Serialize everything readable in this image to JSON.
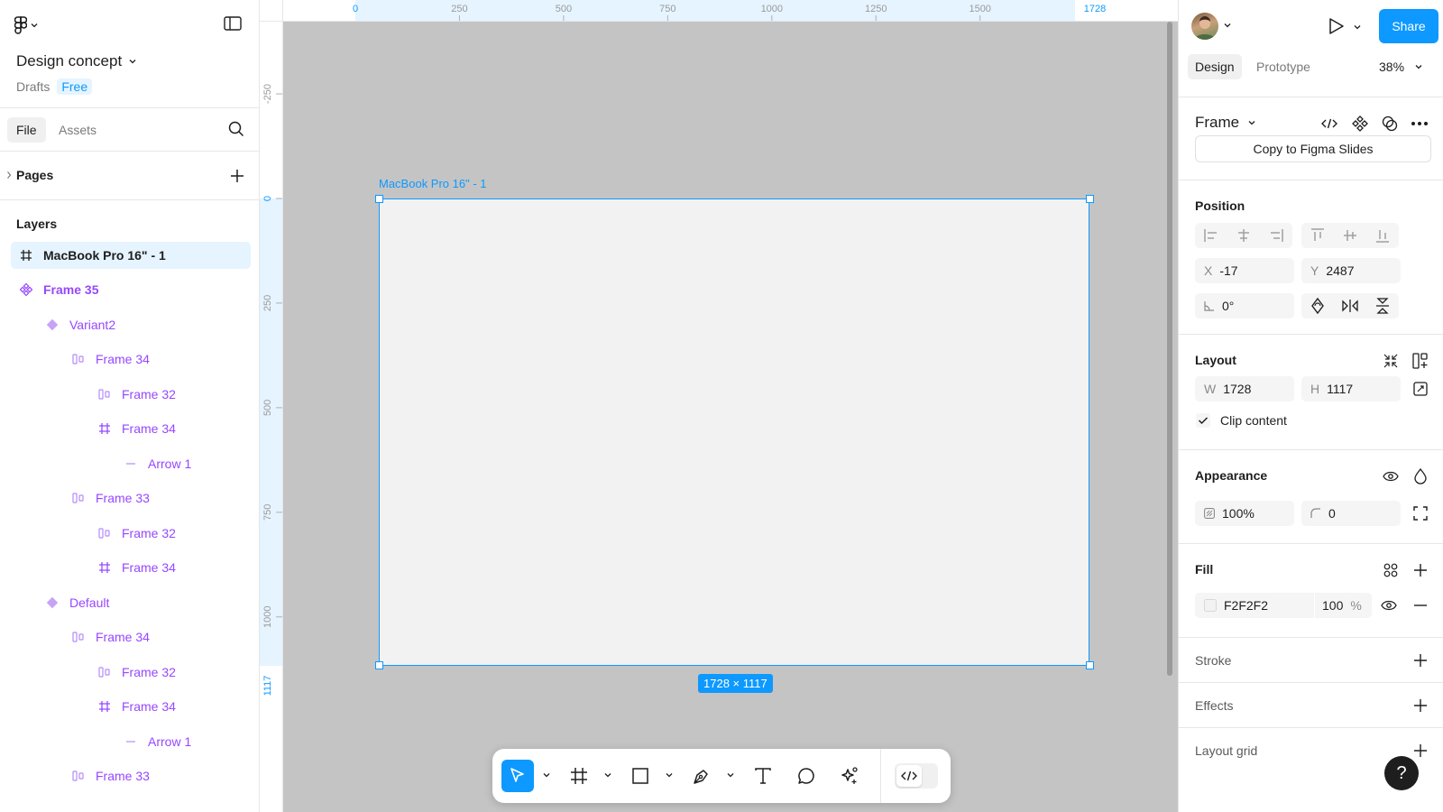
{
  "file": {
    "title": "Design concept",
    "location": "Drafts",
    "plan": "Free"
  },
  "left_tabs": {
    "file": "File",
    "assets": "Assets"
  },
  "pages": {
    "label": "Pages"
  },
  "layers": {
    "label": "Layers",
    "items": [
      {
        "name": "MacBook Pro 16\" - 1",
        "icon": "frame-icon",
        "depth": 0,
        "selected": true
      },
      {
        "name": "Frame 35",
        "icon": "component-set-icon",
        "depth": 0
      },
      {
        "name": "Variant2",
        "icon": "variant-icon",
        "depth": 1
      },
      {
        "name": "Frame 34",
        "icon": "auto-layout-icon",
        "depth": 2
      },
      {
        "name": "Frame 32",
        "icon": "auto-layout-icon",
        "depth": 3
      },
      {
        "name": "Frame 34",
        "icon": "frame-icon",
        "depth": 3
      },
      {
        "name": "Arrow 1",
        "icon": "line-icon",
        "depth": 4
      },
      {
        "name": "Frame 33",
        "icon": "auto-layout-icon",
        "depth": 2
      },
      {
        "name": "Frame 32",
        "icon": "auto-layout-icon",
        "depth": 3
      },
      {
        "name": "Frame 34",
        "icon": "frame-icon",
        "depth": 3
      },
      {
        "name": "Default",
        "icon": "variant-icon",
        "depth": 1
      },
      {
        "name": "Frame 34",
        "icon": "auto-layout-icon",
        "depth": 2
      },
      {
        "name": "Frame 32",
        "icon": "auto-layout-icon",
        "depth": 3
      },
      {
        "name": "Frame 34",
        "icon": "frame-icon",
        "depth": 3
      },
      {
        "name": "Arrow 1",
        "icon": "line-icon",
        "depth": 4
      },
      {
        "name": "Frame 33",
        "icon": "auto-layout-icon",
        "depth": 2
      }
    ]
  },
  "ruler_top": {
    "start": "0",
    "ticks": [
      "250",
      "500",
      "750",
      "1000",
      "1250",
      "1500"
    ],
    "end": "1728"
  },
  "ruler_left": {
    "ticks": [
      "-250",
      "0",
      "250",
      "500",
      "750",
      "1000"
    ],
    "end": "1117"
  },
  "canvas": {
    "frame_label": "MacBook Pro 16\" - 1",
    "size_badge": "1728 × 1117"
  },
  "right": {
    "share": "Share",
    "tabs": {
      "design": "Design",
      "prototype": "Prototype"
    },
    "zoom": "38%",
    "layer_type": "Frame",
    "copy_button": "Copy to Figma Slides",
    "position": {
      "title": "Position",
      "x_label": "X",
      "x": "-17",
      "y_label": "Y",
      "y": "2487",
      "rotation": "0°"
    },
    "layout": {
      "title": "Layout",
      "w_label": "W",
      "w": "1728",
      "h_label": "H",
      "h": "1117",
      "clip": "Clip content"
    },
    "appearance": {
      "title": "Appearance",
      "opacity": "100%",
      "radius": "0"
    },
    "fill": {
      "title": "Fill",
      "hex": "F2F2F2",
      "opacity": "100",
      "unit": "%"
    },
    "stroke": {
      "title": "Stroke"
    },
    "effects": {
      "title": "Effects"
    },
    "layout_grid": {
      "title": "Layout grid"
    }
  },
  "help": "?",
  "colors": {
    "accent": "#0d99ff",
    "component": "#9747ff",
    "canvas": "#c4c4c4",
    "frame_fill": "#f2f2f2"
  }
}
